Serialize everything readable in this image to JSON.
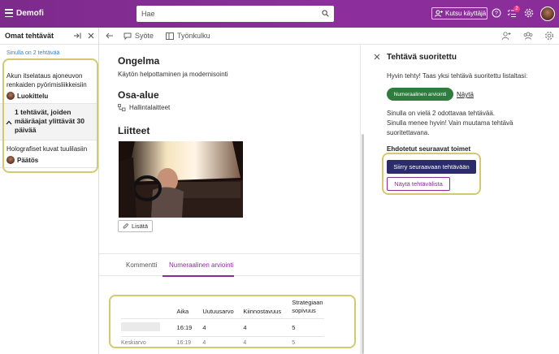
{
  "header": {
    "brand": "Demofi",
    "search_placeholder": "Hae",
    "invite_label": "Kutsu käyttäjä",
    "tasks_badge": "2",
    "accent": "#8a2d99"
  },
  "left_panel": {
    "title": "Omat tehtävät",
    "count_text": "Sinulla on 2 tehtävää",
    "tasks": [
      {
        "title": "Akun itselataus ajoneuvon renkaiden pyörimisliikkeisiin",
        "stage": "Luokittelu"
      },
      {
        "title": "Holografiset kuvat tuulilasiin",
        "stage": "Päätös"
      }
    ],
    "overdue_text": "1 tehtävät, joiden määräajat ylittävät 30 päivää"
  },
  "toolbar": {
    "tab_feed": "Syöte",
    "tab_workflow": "Työnkulku"
  },
  "content": {
    "problem_heading": "Ongelma",
    "problem_text": "Käytön helpottaminen ja modernisointi",
    "subarea_heading": "Osa-alue",
    "subarea_value": "Hallintalaitteet",
    "attachments_heading": "Liitteet",
    "add_label": "Lisätä",
    "tabs": [
      "Kommentti",
      "Numeraalinen arviointi"
    ],
    "active_tab": "Numeraalinen arviointi"
  },
  "ratings": {
    "columns": [
      "",
      "Aika",
      "Uutuusarvo",
      "Kiinnostavuus",
      "Strategiaan sopivuus"
    ],
    "rows": [
      [
        "",
        "16:19",
        "4",
        "4",
        "5"
      ],
      [
        "Keskiarvo",
        "16:19",
        "4",
        "4",
        "5"
      ]
    ]
  },
  "right_panel": {
    "title": "Tehtävä suoritettu",
    "message": "Hyvin tehty! Taas yksi tehtävä suoritettu listaltasi:",
    "completed_pill": "Numeraalinen arviointi",
    "show_link": "Näytä",
    "remaining_line1": "Sinulla on vielä 2 odottavaa tehtävää.",
    "remaining_line2": "Sinulla menee hyvin! Vain muutama tehtävä suoritettavana.",
    "next_steps_heading": "Ehdotetut seuraavat toimet",
    "next_task_button": "Siirry seuraavaan tehtävään",
    "show_list_button": "Näytä tehtävälista"
  }
}
